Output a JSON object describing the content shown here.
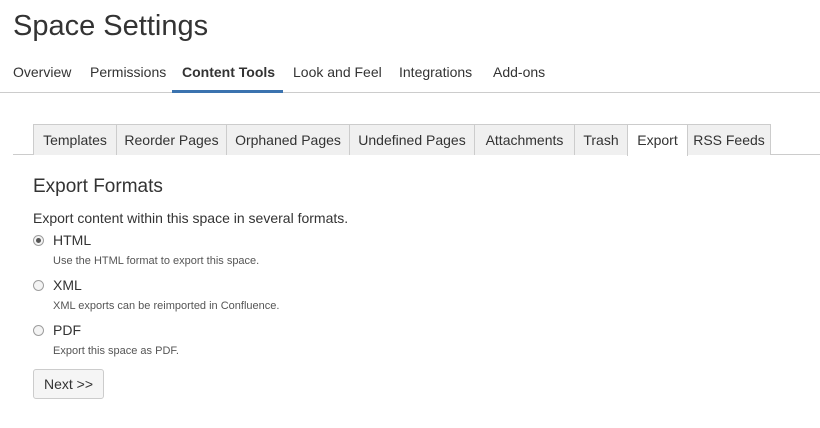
{
  "page": {
    "title": "Space Settings"
  },
  "top_nav": {
    "items": [
      {
        "label": "Overview"
      },
      {
        "label": "Permissions"
      },
      {
        "label": "Content Tools",
        "active": true
      },
      {
        "label": "Look and Feel"
      },
      {
        "label": "Integrations"
      },
      {
        "label": "Add-ons"
      }
    ]
  },
  "sub_tabs": {
    "items": [
      {
        "label": "Templates"
      },
      {
        "label": "Reorder Pages"
      },
      {
        "label": "Orphaned Pages"
      },
      {
        "label": "Undefined Pages"
      },
      {
        "label": "Attachments"
      },
      {
        "label": "Trash"
      },
      {
        "label": "Export",
        "active": true
      },
      {
        "label": "RSS Feeds"
      }
    ]
  },
  "export": {
    "heading": "Export Formats",
    "intro": "Export content within this space in several formats.",
    "options": [
      {
        "label": "HTML",
        "description": "Use the HTML format to export this space.",
        "checked": true
      },
      {
        "label": "XML",
        "description": "XML exports can be reimported in Confluence.",
        "checked": false
      },
      {
        "label": "PDF",
        "description": "Export this space as PDF.",
        "checked": false
      }
    ],
    "next_label": "Next >>"
  },
  "colors": {
    "accent": "#3b73af",
    "tab_bg": "#f0f0f0",
    "border": "#cccccc"
  }
}
